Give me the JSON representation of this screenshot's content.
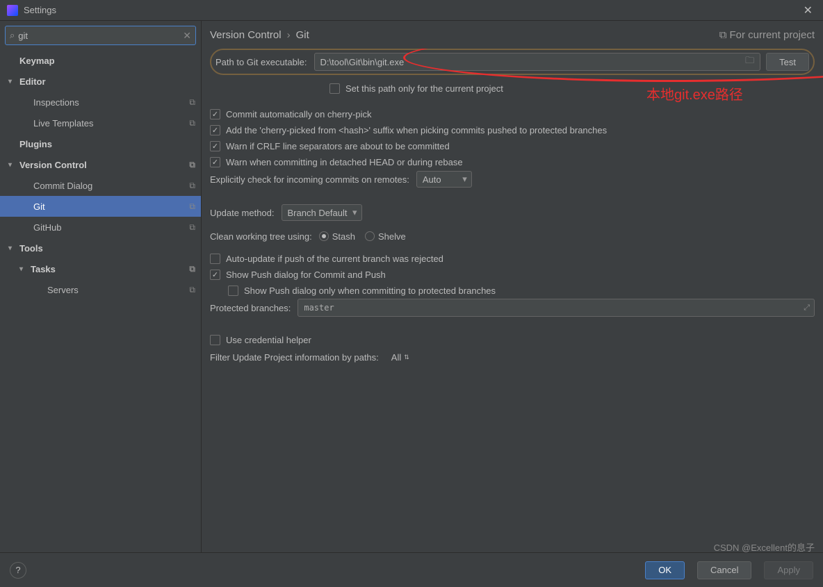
{
  "titlebar": {
    "title": "Settings"
  },
  "search": {
    "value": "git"
  },
  "sidebar": {
    "items": [
      {
        "label": "Keymap",
        "level": "l1 l1nc",
        "copyable": false
      },
      {
        "label": "Editor",
        "level": "l1 l1nc",
        "arrow": "▾",
        "copyable": false
      },
      {
        "label": "Inspections",
        "level": "l2",
        "copyable": true
      },
      {
        "label": "Live Templates",
        "level": "l2",
        "copyable": true
      },
      {
        "label": "Plugins",
        "level": "l1 l1nc",
        "copyable": false
      },
      {
        "label": "Version Control",
        "level": "l1 l1nc",
        "arrow": "▾",
        "copyable": true
      },
      {
        "label": "Commit Dialog",
        "level": "l2",
        "copyable": true
      },
      {
        "label": "Git",
        "level": "l2",
        "selected": true,
        "copyable": true
      },
      {
        "label": "GitHub",
        "level": "l2",
        "copyable": true
      },
      {
        "label": "Tools",
        "level": "l1 l1nc",
        "arrow": "▾",
        "copyable": false
      },
      {
        "label": "Tasks",
        "level": "l1",
        "arrow": "▾",
        "copyable": true
      },
      {
        "label": "Servers",
        "level": "l3",
        "copyable": true
      }
    ]
  },
  "breadcrumb": {
    "a": "Version Control",
    "b": "Git",
    "sub": "For current project"
  },
  "form": {
    "path_label": "Path to Git executable:",
    "path_value": "D:\\tool\\Git\\bin\\git.exe",
    "test_btn": "Test",
    "set_path_only": "Set this path only for the current project",
    "cherry_auto": "Commit automatically on cherry-pick",
    "cherry_suffix": "Add the 'cherry-picked from <hash>' suffix when picking commits pushed to protected branches",
    "crlf_warn": "Warn if CRLF line separators are about to be committed",
    "detached_warn": "Warn when committing in detached HEAD or during rebase",
    "explicit_check": "Explicitly check for incoming commits on remotes:",
    "explicit_value": "Auto",
    "update_method_lbl": "Update method:",
    "update_method_val": "Branch Default",
    "clean_tree_lbl": "Clean working tree using:",
    "clean_stash": "Stash",
    "clean_shelve": "Shelve",
    "auto_update_push": "Auto-update if push of the current branch was rejected",
    "show_push_dlg": "Show Push dialog for Commit and Push",
    "show_push_protected": "Show Push dialog only when committing to protected branches",
    "protected_lbl": "Protected branches:",
    "protected_val": "master",
    "use_cred": "Use credential helper",
    "filter_lbl": "Filter Update Project information by paths:",
    "filter_val": "All"
  },
  "annotation": "本地git.exe路径",
  "footer": {
    "ok": "OK",
    "cancel": "Cancel",
    "apply": "Apply"
  },
  "watermark": "CSDN @Excellent的息子"
}
